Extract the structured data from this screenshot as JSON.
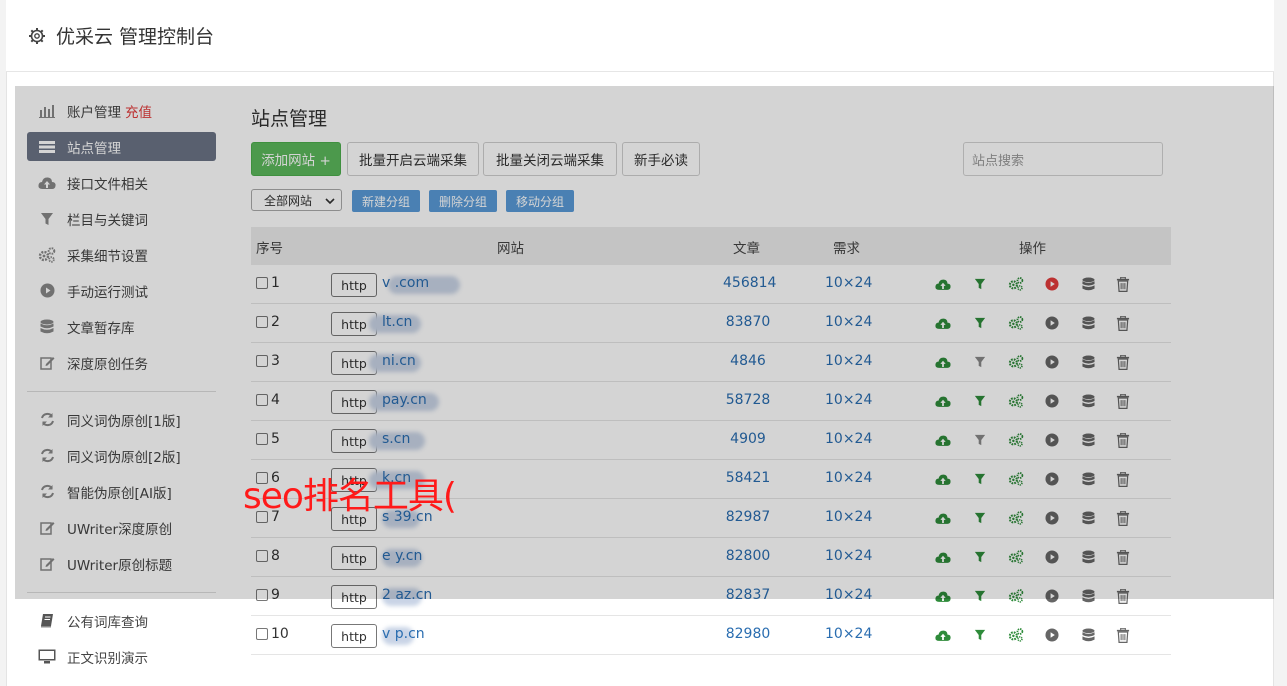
{
  "header": {
    "title": "优采云 管理控制台",
    "icon": "gear-icon"
  },
  "sidebar": {
    "items": [
      {
        "label": "账户管理",
        "icon": "bar-chart-icon",
        "extra": "充值"
      },
      {
        "label": "站点管理",
        "icon": "server-list-icon",
        "active": true
      },
      {
        "label": "接口文件相关",
        "icon": "cloud-upload-icon"
      },
      {
        "label": "栏目与关键词",
        "icon": "filter-icon"
      },
      {
        "label": "采集细节设置",
        "icon": "cogs-icon"
      },
      {
        "label": "手动运行测试",
        "icon": "play-circle-icon"
      },
      {
        "label": "文章暂存库",
        "icon": "database-icon"
      },
      {
        "label": "深度原创任务",
        "icon": "edit-icon"
      },
      {
        "label": "同义词伪原创[1版]",
        "icon": "refresh-icon"
      },
      {
        "label": "同义词伪原创[2版]",
        "icon": "refresh-icon"
      },
      {
        "label": "智能伪原创[AI版]",
        "icon": "refresh-icon"
      },
      {
        "label": "UWriter深度原创",
        "icon": "edit-icon"
      },
      {
        "label": "UWriter原创标题",
        "icon": "edit-icon"
      },
      {
        "label": "公有词库查询",
        "icon": "book-icon"
      },
      {
        "label": "正文识别演示",
        "icon": "monitor-icon"
      }
    ]
  },
  "main": {
    "title": "站点管理",
    "buttons": {
      "add_site": "添加网站 +",
      "batch_on": "批量开启云端采集",
      "batch_off": "批量关闭云端采集",
      "guide": "新手必读"
    },
    "search_placeholder": "站点搜索",
    "group_select": "全部网站",
    "group_buttons": {
      "new": "新建分组",
      "delete": "删除分组",
      "move": "移动分组"
    },
    "table": {
      "headers": {
        "no": "序号",
        "site": "网站",
        "articles": "文章",
        "demand": "需求",
        "ops": "操作"
      },
      "rows": [
        {
          "no": "1",
          "protocol": "http",
          "site": "v .com",
          "articles": "456814",
          "demand": "10×24",
          "run_active": true,
          "filter_gray": false
        },
        {
          "no": "2",
          "protocol": "http",
          "site": "lt.cn",
          "articles": "83870",
          "demand": "10×24",
          "run_active": false,
          "filter_gray": false
        },
        {
          "no": "3",
          "protocol": "http",
          "site": "ni.cn",
          "articles": "4846",
          "demand": "10×24",
          "run_active": false,
          "filter_gray": true
        },
        {
          "no": "4",
          "protocol": "http",
          "site": "pay.cn",
          "articles": "58728",
          "demand": "10×24",
          "run_active": false,
          "filter_gray": false
        },
        {
          "no": "5",
          "protocol": "http",
          "site": "s.cn",
          "articles": "4909",
          "demand": "10×24",
          "run_active": false,
          "filter_gray": true
        },
        {
          "no": "6",
          "protocol": "http",
          "site": "k.cn",
          "articles": "58421",
          "demand": "10×24",
          "run_active": false,
          "filter_gray": false
        },
        {
          "no": "7",
          "protocol": "http",
          "site": "s 39.cn",
          "articles": "82987",
          "demand": "10×24",
          "run_active": false,
          "filter_gray": false
        },
        {
          "no": "8",
          "protocol": "http",
          "site": "e y.cn",
          "articles": "82800",
          "demand": "10×24",
          "run_active": false,
          "filter_gray": false
        },
        {
          "no": "9",
          "protocol": "http",
          "site": "2 az.cn",
          "articles": "82837",
          "demand": "10×24",
          "run_active": false,
          "filter_gray": false
        },
        {
          "no": "10",
          "protocol": "http",
          "site": "v p.cn",
          "articles": "82980",
          "demand": "10×24",
          "run_active": false,
          "filter_gray": false
        }
      ]
    }
  },
  "watermark": "seo排名工具(",
  "colors": {
    "green": "#5cb85c",
    "active_side": "#6b7486",
    "link": "#2a6db0",
    "group_btn": "#5a9bd8",
    "red": "#e23b3b",
    "op_green": "#2e8b3a"
  }
}
